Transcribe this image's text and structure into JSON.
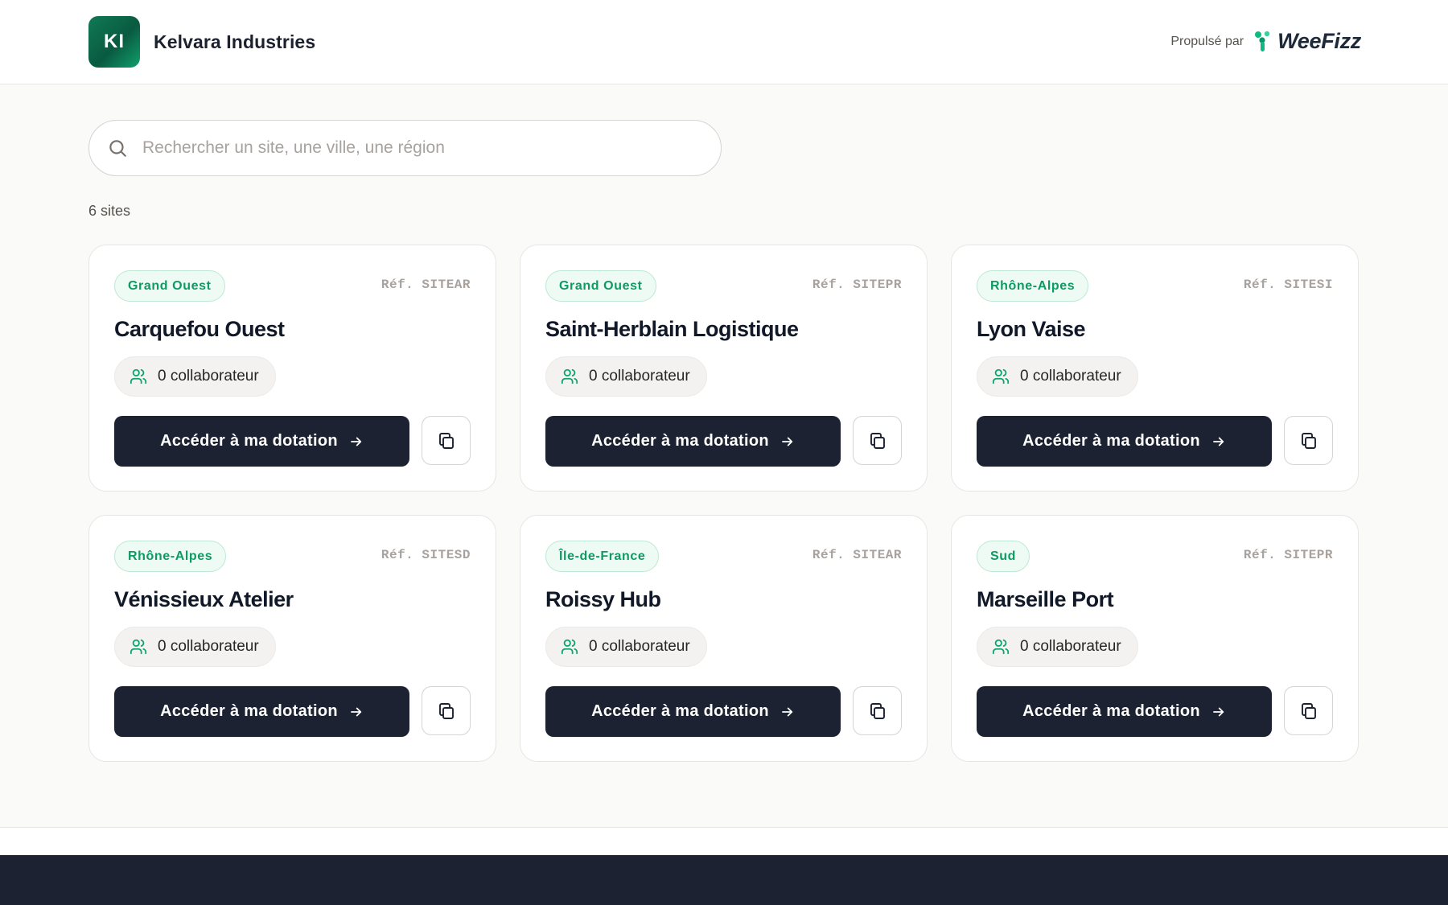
{
  "header": {
    "company_initials": "KI",
    "company_name": "Kelvara Industries",
    "powered_by_label": "Propulsé par",
    "partner_name": "WeeFizz"
  },
  "search": {
    "placeholder": "Rechercher un site, une ville, une région",
    "value": ""
  },
  "results": {
    "count_label": "6 sites"
  },
  "sites": [
    {
      "region": "Grand Ouest",
      "ref": "Réf. SITEAR",
      "name": "Carquefou Ouest",
      "collaborators": "0 collaborateur",
      "cta": "Accéder à ma dotation"
    },
    {
      "region": "Grand Ouest",
      "ref": "Réf. SITEPR",
      "name": "Saint-Herblain Logistique",
      "collaborators": "0 collaborateur",
      "cta": "Accéder à ma dotation"
    },
    {
      "region": "Rhône-Alpes",
      "ref": "Réf. SITESI",
      "name": "Lyon Vaise",
      "collaborators": "0 collaborateur",
      "cta": "Accéder à ma dotation"
    },
    {
      "region": "Rhône-Alpes",
      "ref": "Réf. SITESD",
      "name": "Vénissieux Atelier",
      "collaborators": "0 collaborateur",
      "cta": "Accéder à ma dotation"
    },
    {
      "region": "Île-de-France",
      "ref": "Réf. SITEAR",
      "name": "Roissy Hub",
      "collaborators": "0 collaborateur",
      "cta": "Accéder à ma dotation"
    },
    {
      "region": "Sud",
      "ref": "Réf. SITEPR",
      "name": "Marseille Port",
      "collaborators": "0 collaborateur",
      "cta": "Accéder à ma dotation"
    }
  ],
  "icons": {
    "search": "search-icon",
    "users": "users-icon",
    "arrow": "arrow-right-icon",
    "copy": "copy-icon"
  },
  "colors": {
    "brand_green": "#0f9a63",
    "logo_gradient_start": "#0f7a55",
    "cta_background": "#1c2231",
    "footer_background": "#1c2231",
    "page_background": "#fafaf9"
  }
}
